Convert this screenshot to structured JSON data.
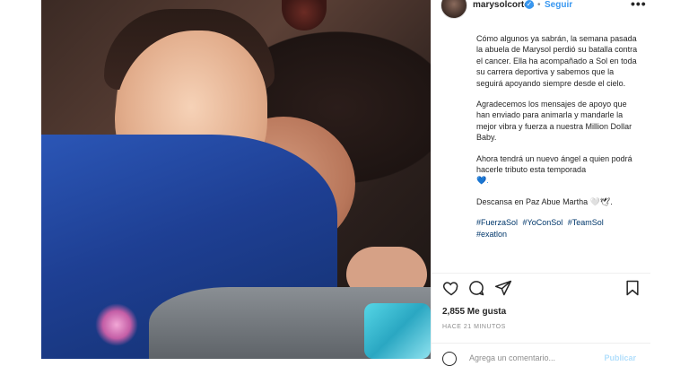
{
  "post": {
    "username": "marysolcortes",
    "verified_mark": "✓",
    "separator": "•",
    "follow_label": "Seguir",
    "more_label": "•••",
    "caption": {
      "p1": "Cómo algunos ya sabrán, la semana pasada la abuela de Marysol perdió su batalla contra el cancer. Ella ha acompañado a Sol en toda su carrera deportiva y sabemos que la seguirá apoyando siempre desde el cielo.",
      "p2": "Agradecemos los mensajes de apoyo que han enviado para animarla y mandarle la mejor vibra y fuerza a nuestra Million Dollar Baby.",
      "p3": "Ahora tendrá un nuevo ángel a quien podrá hacerle tributo esta temporada",
      "p3_emoji": "💙.",
      "p4": "Descansa en Paz Abue Martha 🤍🕊.",
      "tags": [
        "#FuerzaSol",
        "#YoConSol",
        "#TeamSol",
        "#exatlon"
      ]
    },
    "likes": "2,855 Me gusta",
    "time": "HACE 21 MINUTOS",
    "comment_placeholder": "Agrega un comentario...",
    "publish_label": "Publicar"
  }
}
